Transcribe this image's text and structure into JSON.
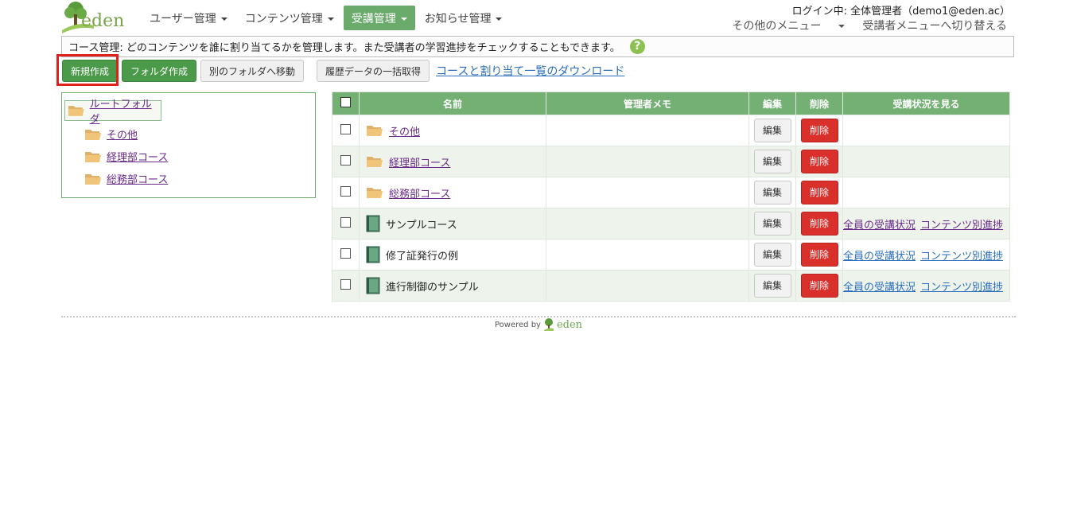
{
  "header": {
    "logo_text": "eden",
    "nav": [
      {
        "label": "ユーザー管理",
        "active": false
      },
      {
        "label": "コンテンツ管理",
        "active": false
      },
      {
        "label": "受講管理",
        "active": true
      },
      {
        "label": "お知らせ管理",
        "active": false
      }
    ],
    "login_info": "ログイン中: 全体管理者（demo1@eden.ac）",
    "other_menu": "その他のメニュー",
    "switch_menu": "受講者メニューへ切り替える"
  },
  "info_bar": {
    "text": "コース管理: どのコンテンツを誰に割り当てるかを管理します。また受講者の学習進捗をチェックすることもできます。",
    "help": "?"
  },
  "toolbar": {
    "new_label": "新規作成",
    "folder_label": "フォルダ作成",
    "move_label": "別のフォルダへ移動",
    "history_label": "履歴データの一括取得",
    "download_label": "コースと割り当て一覧のダウンロード"
  },
  "tree": {
    "root": "ルートフォルダ",
    "children": [
      "その他",
      "経理部コース",
      "総務部コース"
    ]
  },
  "table": {
    "headers": {
      "name": "名前",
      "memo": "管理者メモ",
      "edit": "編集",
      "delete": "削除",
      "status": "受講状況を見る"
    },
    "edit_label": "編集",
    "delete_label": "削除",
    "rows": [
      {
        "type": "folder",
        "name": "その他",
        "memo": "",
        "all_status": "",
        "content_progress": ""
      },
      {
        "type": "folder",
        "name": "経理部コース",
        "memo": "",
        "all_status": "",
        "content_progress": ""
      },
      {
        "type": "folder",
        "name": "総務部コース",
        "memo": "",
        "all_status": "",
        "content_progress": ""
      },
      {
        "type": "course",
        "name": "サンプルコース",
        "memo": "",
        "all_status": "全員の受講状況",
        "content_progress": "コンテンツ別進捗"
      },
      {
        "type": "course",
        "name": "修了証発行の例",
        "memo": "",
        "all_status": "全員の受講状況",
        "content_progress": "コンテンツ別進捗"
      },
      {
        "type": "course",
        "name": "進行制御のサンプル",
        "memo": "",
        "all_status": "全員の受講状況",
        "content_progress": "コンテンツ別進捗"
      }
    ]
  },
  "footer": {
    "powered_by": "Powered by",
    "logo_text": "eden"
  },
  "colors": {
    "primary_green": "#4a9a4a",
    "header_green": "#74b074",
    "delete_red": "#d9302c",
    "link_blue": "#2a6ebb",
    "visited_purple": "#6a2a8a"
  }
}
